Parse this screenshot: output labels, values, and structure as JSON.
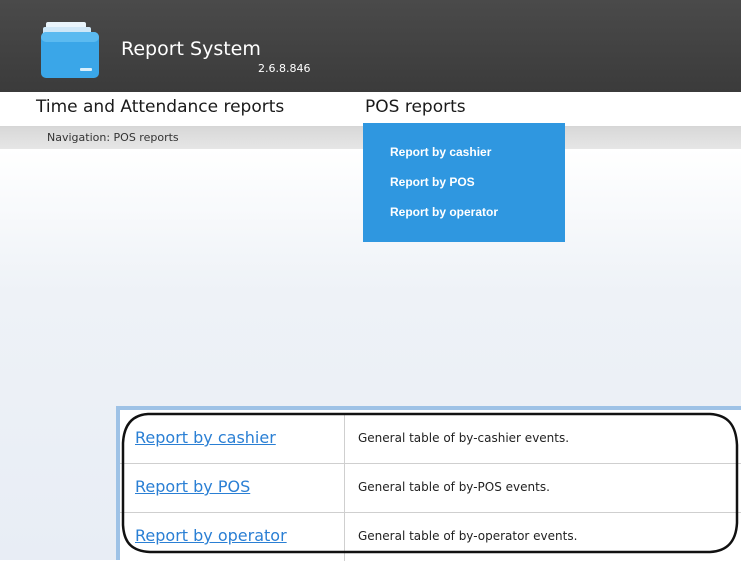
{
  "header": {
    "title": "Report System",
    "version": "2.6.8.846",
    "logo_icon": "folder-icon"
  },
  "menu": {
    "items": [
      {
        "label": "Time and Attendance reports"
      },
      {
        "label": "POS reports"
      }
    ]
  },
  "navigation": {
    "label": "Navigation: POS reports"
  },
  "dropdown": {
    "items": [
      {
        "label": "Report by cashier"
      },
      {
        "label": "Report by POS"
      },
      {
        "label": "Report by operator"
      }
    ]
  },
  "report_table": {
    "rows": [
      {
        "link": "Report by cashier",
        "description": "General table of by-cashier events."
      },
      {
        "link": "Report by POS",
        "description": "General table of by-POS events."
      },
      {
        "link": "Report by operator",
        "description": "General table of by-operator events."
      }
    ]
  },
  "colors": {
    "header_bg": "#404040",
    "dropdown_bg": "#2f97e0",
    "link": "#2a7fd4",
    "table_frame": "#9ec2e6"
  }
}
